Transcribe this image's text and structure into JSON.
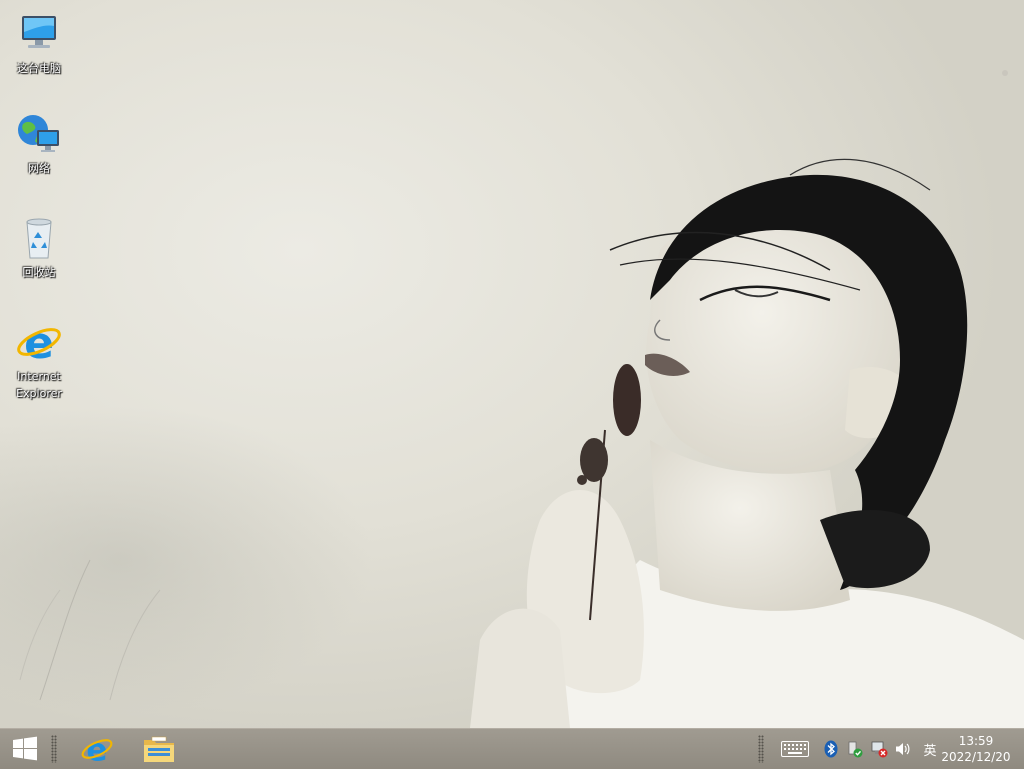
{
  "desktop": {
    "icons": [
      {
        "label": "这台电脑",
        "icon": "this-pc-icon"
      },
      {
        "label": "网络",
        "icon": "network-icon"
      },
      {
        "label": "回收站",
        "icon": "recycle-bin-icon"
      },
      {
        "label": "Internet Explorer",
        "icon": "internet-explorer-icon"
      }
    ],
    "wallpaper": "monochrome-portrait-wallpaper"
  },
  "taskbar": {
    "start_icon": "windows-logo-icon",
    "pinned": [
      "internet-explorer-icon",
      "file-explorer-icon"
    ],
    "tray": [
      "touch-keyboard-icon",
      "bluetooth-icon",
      "action-center-icon",
      "network-disconnected-icon",
      "volume-icon"
    ],
    "input_language": "英",
    "clock": {
      "time": "13:59",
      "date": "2022/12/20"
    },
    "colors": {
      "taskbar": "#958f86",
      "accent_ie": "#1e90e0"
    }
  }
}
